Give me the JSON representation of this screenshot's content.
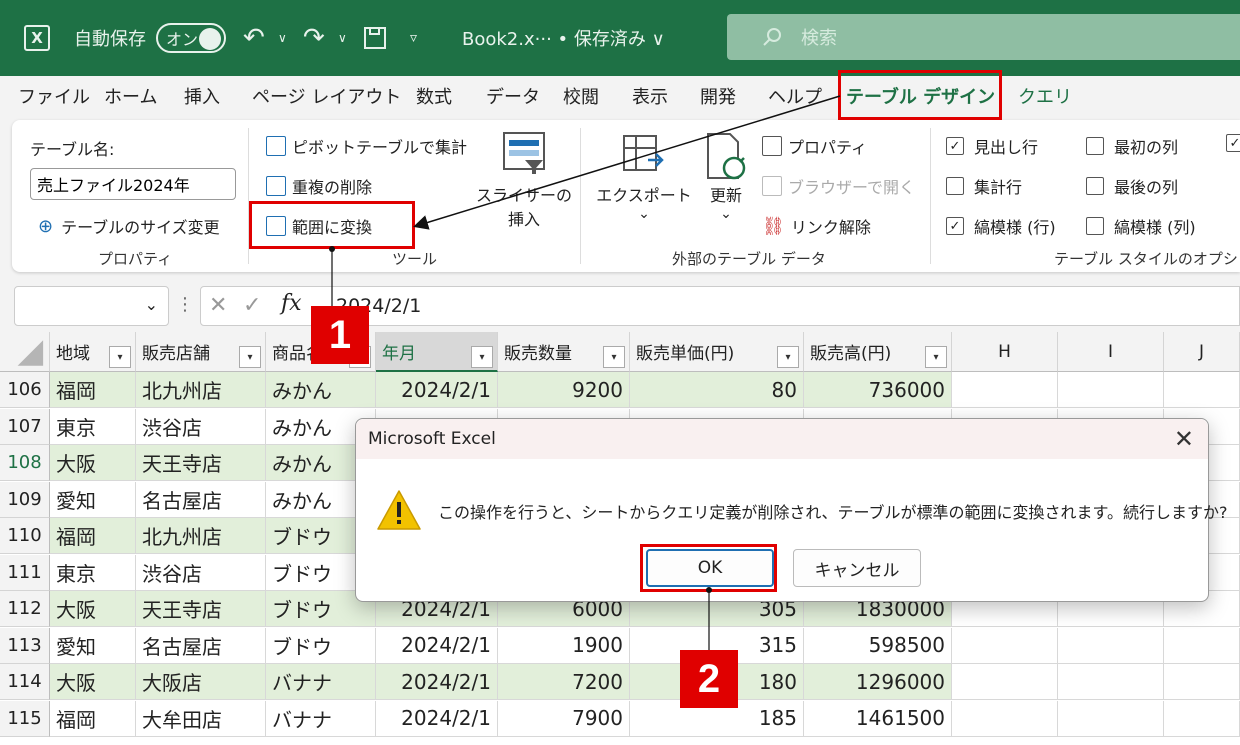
{
  "titlebar": {
    "autosave_label": "自動保存",
    "toggle_label": "オン",
    "doc_title": "Book2.x··· • 保存済み ∨",
    "search_placeholder": "検索"
  },
  "menu": {
    "items": [
      "ファイル",
      "ホーム",
      "挿入",
      "ページ レイアウト",
      "数式",
      "データ",
      "校閲",
      "表示",
      "開発",
      "ヘルプ",
      "テーブル デザイン",
      "クエリ"
    ]
  },
  "ribbon": {
    "properties": {
      "table_name_label": "テーブル名:",
      "table_name_value": "売上ファイル2024年",
      "resize_label": "テーブルのサイズ変更",
      "group_label": "プロパティ"
    },
    "tools": {
      "pivot_label": "ピボットテーブルで集計",
      "remove_dup_label": "重複の削除",
      "convert_label": "範囲に変換",
      "slicer_label_1": "スライサーの",
      "slicer_label_2": "挿入",
      "group_label": "ツール"
    },
    "external": {
      "export_label": "エクスポート",
      "refresh_label": "更新",
      "properties_label": "プロパティ",
      "open_browser_label": "ブラウザーで開く",
      "unlink_label": "リンク解除",
      "group_label": "外部のテーブル データ"
    },
    "style_options": {
      "header_row": "見出し行",
      "first_col": "最初の列",
      "total_row": "集計行",
      "last_col": "最後の列",
      "banded_rows": "縞模様 (行)",
      "banded_cols": "縞模様 (列)",
      "group_label": "テーブル スタイルのオプション",
      "header_row_checked": "✓",
      "banded_rows_checked": "✓"
    }
  },
  "formula": {
    "value": "2024/2/1"
  },
  "grid": {
    "headers": [
      "地域",
      "販売店舗",
      "商品名",
      "年月",
      "販売数量",
      "販売単価(円)",
      "販売高(円)"
    ],
    "extra_cols": [
      "H",
      "I",
      "J"
    ],
    "rows": [
      {
        "num": "106",
        "cells": [
          "福岡",
          "北九州店",
          "みかん",
          "2024/2/1",
          "9200",
          "80",
          "736000"
        ]
      },
      {
        "num": "107",
        "cells": [
          "東京",
          "渋谷店",
          "みかん",
          "",
          "",
          "",
          ""
        ]
      },
      {
        "num": "108",
        "cells": [
          "大阪",
          "天王寺店",
          "みかん",
          "",
          "",
          "",
          ""
        ]
      },
      {
        "num": "109",
        "cells": [
          "愛知",
          "名古屋店",
          "みかん",
          "",
          "",
          "",
          ""
        ]
      },
      {
        "num": "110",
        "cells": [
          "福岡",
          "北九州店",
          "ブドウ",
          "",
          "",
          "",
          ""
        ]
      },
      {
        "num": "111",
        "cells": [
          "東京",
          "渋谷店",
          "ブドウ",
          "",
          "",
          "",
          ""
        ]
      },
      {
        "num": "112",
        "cells": [
          "大阪",
          "天王寺店",
          "ブドウ",
          "2024/2/1",
          "6000",
          "305",
          "1830000"
        ]
      },
      {
        "num": "113",
        "cells": [
          "愛知",
          "名古屋店",
          "ブドウ",
          "2024/2/1",
          "1900",
          "315",
          "598500"
        ]
      },
      {
        "num": "114",
        "cells": [
          "大阪",
          "大阪店",
          "バナナ",
          "2024/2/1",
          "7200",
          "180",
          "1296000"
        ]
      },
      {
        "num": "115",
        "cells": [
          "福岡",
          "大牟田店",
          "バナナ",
          "2024/2/1",
          "7900",
          "185",
          "1461500"
        ]
      }
    ]
  },
  "dialog": {
    "title": "Microsoft Excel",
    "message": "この操作を行うと、シートからクエリ定義が削除され、テーブルが標準の範囲に変換されます。続行しますか?",
    "ok_label": "OK",
    "cancel_label": "キャンセル"
  },
  "annotations": {
    "step1": "1",
    "step2": "2",
    "color": "#e00000"
  },
  "colors": {
    "excel_green": "#1e7145",
    "band_green": "#e2efda"
  }
}
